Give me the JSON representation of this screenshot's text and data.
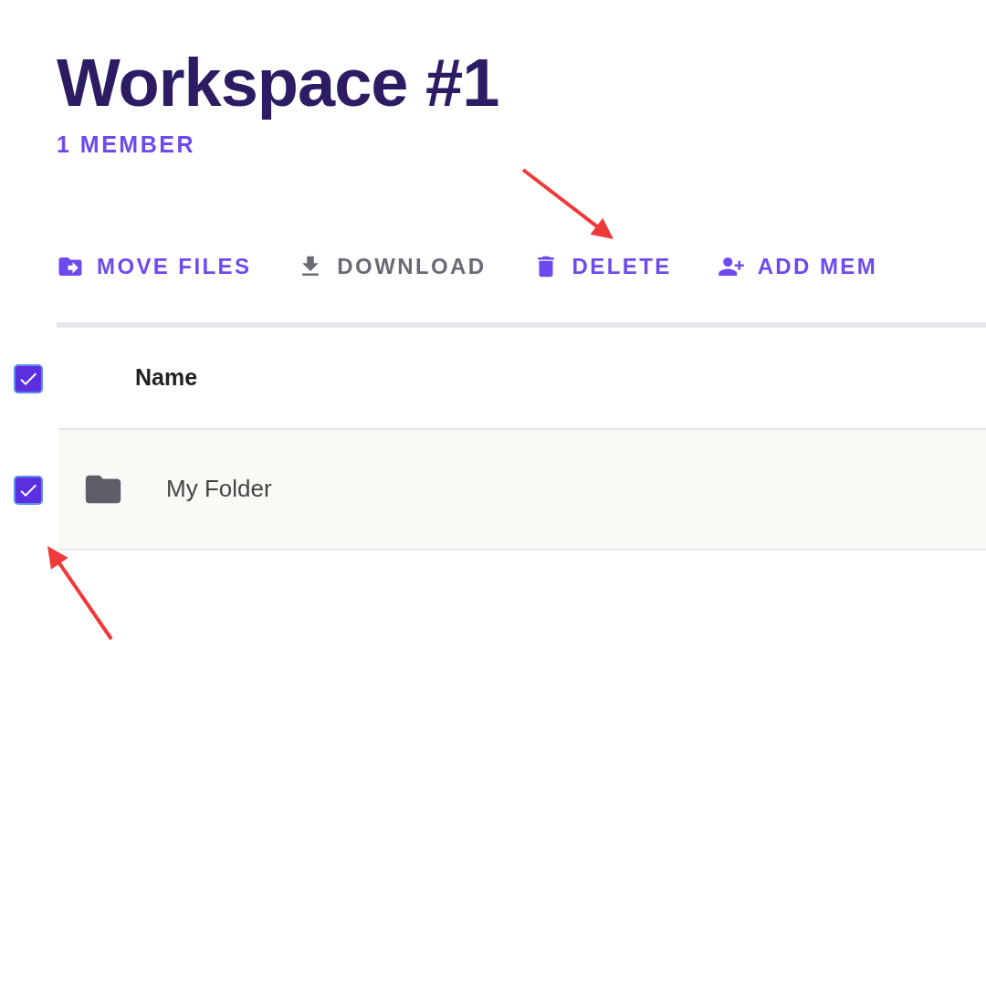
{
  "header": {
    "title": "Workspace #1",
    "subtitle": "1 MEMBER"
  },
  "toolbar": [
    {
      "kind": "move",
      "label": "MOVE FILES",
      "disabled": false
    },
    {
      "kind": "download",
      "label": "DOWNLOAD",
      "disabled": true
    },
    {
      "kind": "delete",
      "label": "DELETE",
      "disabled": false
    },
    {
      "kind": "add_member",
      "label": "ADD MEM",
      "disabled": false
    }
  ],
  "table": {
    "select_all_checked": true,
    "columns": [
      "Name"
    ],
    "rows": [
      {
        "name": "My Folder",
        "checked": true
      }
    ]
  }
}
